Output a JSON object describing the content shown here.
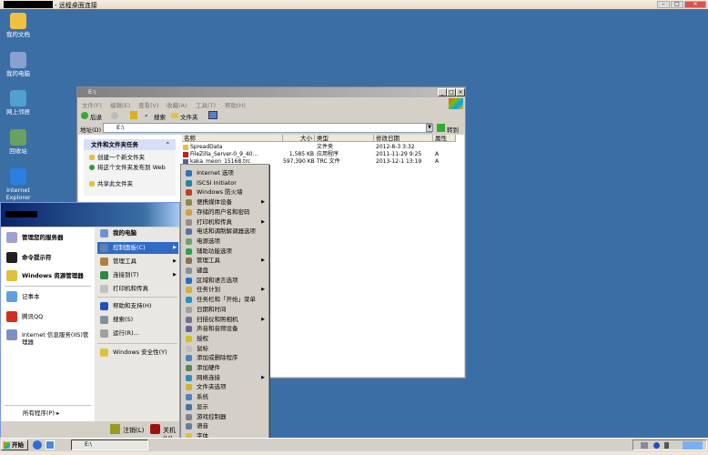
{
  "rdp": {
    "title": "- 远程桌面连接",
    "min": "–",
    "max": "□",
    "close": "✕"
  },
  "desktop_icons": [
    {
      "label": "我的文档",
      "icon": "my-documents-icon"
    },
    {
      "label": "我的电脑",
      "icon": "my-computer-icon"
    },
    {
      "label": "网上邻居",
      "icon": "network-places-icon"
    },
    {
      "label": "回收站",
      "icon": "recycle-bin-icon"
    },
    {
      "label": "Internet Explorer",
      "icon": "internet-explorer-icon"
    }
  ],
  "explorer": {
    "title": "E:\\",
    "menu": [
      "文件(F)",
      "编辑(E)",
      "查看(V)",
      "收藏(A)",
      "工具(T)",
      "帮助(H)"
    ],
    "toolbar": {
      "back": "后退",
      "search": "搜索",
      "folders": "文件夹"
    },
    "address_label": "地址(D)",
    "address_value": "E:\\",
    "go": "转到",
    "tasks_title": "文件和文件夹任务",
    "tasks": [
      "创建一个新文件夹",
      "将这个文件夹发布到 Web",
      "共享此文件夹"
    ],
    "columns": [
      "名称",
      "大小",
      "类型",
      "修改日期",
      "属性"
    ],
    "files": [
      {
        "name": "SpreadData",
        "size": "",
        "type": "文件夹",
        "date": "2012-8-3 3:32",
        "attr": ""
      },
      {
        "name": "FileZilla_Server-0_9_40...",
        "size": "1,585 KB",
        "type": "应用程序",
        "date": "2011-11-29 9:25",
        "attr": "A"
      },
      {
        "name": "kaka_meon_15168.trc",
        "size": "597,390 KB",
        "type": "TRC 文件",
        "date": "2013-12-1 13:19",
        "attr": "A"
      }
    ]
  },
  "start_menu": {
    "left_pinned": [
      "管理您的服务器",
      "命令提示符",
      "Windows 资源管理器"
    ],
    "left_recent": [
      "记事本",
      "腾讯QQ",
      "Internet 信息服务(IIS)管理器"
    ],
    "all_programs": "所有程序(P)",
    "right": [
      {
        "label": "我的电脑",
        "arrow": false
      },
      {
        "label": "控制面板(C)",
        "arrow": true,
        "highlight": true
      },
      {
        "label": "管理工具",
        "arrow": true
      },
      {
        "label": "连接到(T)",
        "arrow": true
      },
      {
        "label": "打印机和传真",
        "arrow": false
      }
    ],
    "right2": [
      "帮助和支持(H)",
      "搜索(S)",
      "运行(R)..."
    ],
    "right3": [
      "Windows 安全性(Y)"
    ],
    "logoff": "注销(L)",
    "shutdown": "关机(U)"
  },
  "control_panel": [
    {
      "label": "Internet 选项"
    },
    {
      "label": "iSCSI Initiator"
    },
    {
      "label": "Windows 防火墙"
    },
    {
      "label": "便携媒体设备",
      "arrow": true
    },
    {
      "label": "存储的用户名和密码"
    },
    {
      "label": "打印机和传真",
      "arrow": true
    },
    {
      "label": "电话和调制解调器选项"
    },
    {
      "label": "电源选项"
    },
    {
      "label": "辅助功能选项"
    },
    {
      "label": "管理工具",
      "arrow": true
    },
    {
      "label": "键盘"
    },
    {
      "label": "区域和语言选项"
    },
    {
      "label": "任务计划",
      "arrow": true
    },
    {
      "label": "任务栏和「开始」菜单"
    },
    {
      "label": "日期和时间"
    },
    {
      "label": "扫描仪和照相机",
      "arrow": true
    },
    {
      "label": "声音和音频设备"
    },
    {
      "label": "授权"
    },
    {
      "label": "鼠标"
    },
    {
      "label": "添加或删除程序"
    },
    {
      "label": "添加硬件"
    },
    {
      "label": "网络连接",
      "arrow": true
    },
    {
      "label": "文件夹选项"
    },
    {
      "label": "系统"
    },
    {
      "label": "显示"
    },
    {
      "label": "游戏控制器"
    },
    {
      "label": "语音"
    },
    {
      "label": "字体"
    },
    {
      "label": "自动更新"
    }
  ],
  "taskbar": {
    "start": "开始",
    "task": "E:\\"
  },
  "colors": {
    "desktop": "#3b6ea5",
    "highlight": "#316ac5"
  }
}
